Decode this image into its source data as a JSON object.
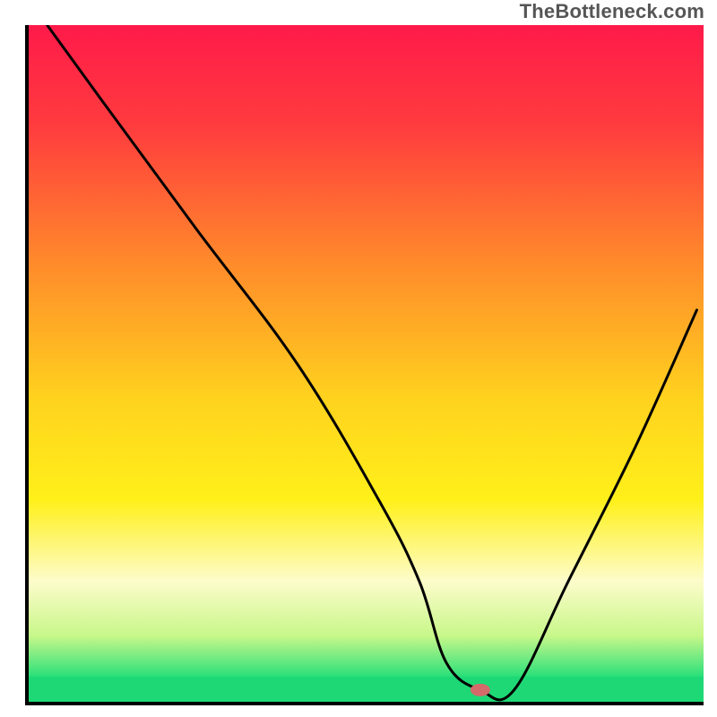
{
  "watermark": "TheBottleneck.com",
  "chart_data": {
    "type": "line",
    "title": "",
    "xlabel": "",
    "ylabel": "",
    "xlim": [
      0,
      100
    ],
    "ylim": [
      0,
      100
    ],
    "axis_ticks_visible": false,
    "gradient_stops": [
      {
        "offset": 0,
        "color": "#ff1a4a"
      },
      {
        "offset": 15,
        "color": "#ff3c3e"
      },
      {
        "offset": 35,
        "color": "#ff8a2b"
      },
      {
        "offset": 55,
        "color": "#ffd21e"
      },
      {
        "offset": 70,
        "color": "#fff01a"
      },
      {
        "offset": 82,
        "color": "#fdfccb"
      },
      {
        "offset": 90,
        "color": "#c8f78a"
      },
      {
        "offset": 96,
        "color": "#2be07a"
      },
      {
        "offset": 100,
        "color": "#1ed876"
      }
    ],
    "green_band": {
      "from_y": 96,
      "to_y": 100,
      "color": "#1ed876"
    },
    "series": [
      {
        "name": "bottleneck-curve",
        "x": [
          3,
          11,
          25,
          40,
          52,
          58,
          62,
          67,
          72,
          80,
          90,
          99
        ],
        "y": [
          100,
          89,
          70,
          50,
          30,
          18,
          6,
          2,
          2,
          18,
          38,
          58
        ]
      }
    ],
    "marker": {
      "name": "optimal-point",
      "x": 67,
      "y": 2,
      "fill": "#d46a6a",
      "rx": 11,
      "ry": 7
    }
  }
}
